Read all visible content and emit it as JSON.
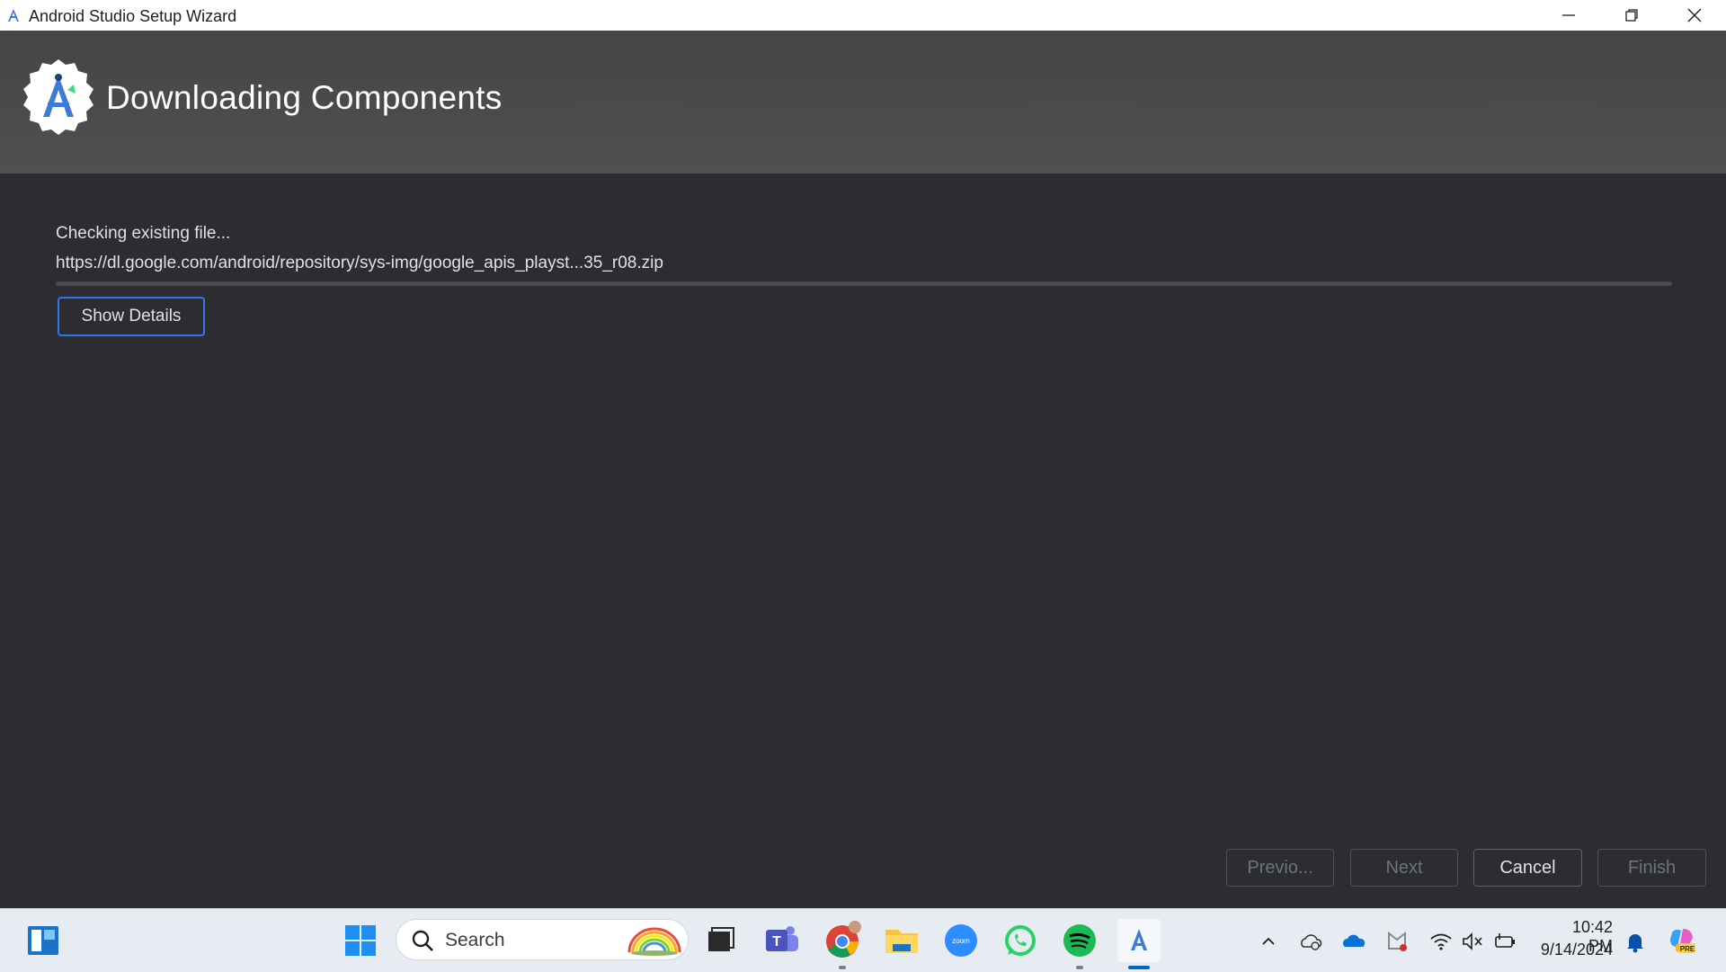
{
  "window": {
    "title": "Android Studio Setup Wizard",
    "controls": [
      "minimize-icon",
      "restore-icon",
      "close-icon"
    ]
  },
  "header": {
    "title": "Downloading Components"
  },
  "content": {
    "status": "Checking existing file...",
    "url": "https://dl.google.com/android/repository/sys-img/google_apis_playst...35_r08.zip",
    "progress": 0,
    "show_details_label": "Show Details"
  },
  "footer": {
    "previous_label": "Previo...",
    "next_label": "Next",
    "cancel_label": "Cancel",
    "finish_label": "Finish"
  },
  "taskbar": {
    "search_placeholder": "Search",
    "apps": [
      "widgets-icon",
      "start-icon",
      "task-view-icon",
      "teams-icon",
      "chrome-icon",
      "file-explorer-icon",
      "zoom-icon",
      "whatsapp-icon",
      "spotify-icon",
      "android-studio-icon"
    ],
    "tray": [
      "chevron-up-icon",
      "onedrive-sync-icon",
      "onedrive-icon",
      "security-icon",
      "wifi-icon",
      "volume-muted-icon",
      "battery-icon",
      "bell-icon",
      "copilot-icon"
    ],
    "time": "10:42 PM",
    "date": "9/14/2024"
  },
  "colors": {
    "background": "#2b2d30",
    "header": "#4a4b4d",
    "accent": "#3574f0"
  }
}
